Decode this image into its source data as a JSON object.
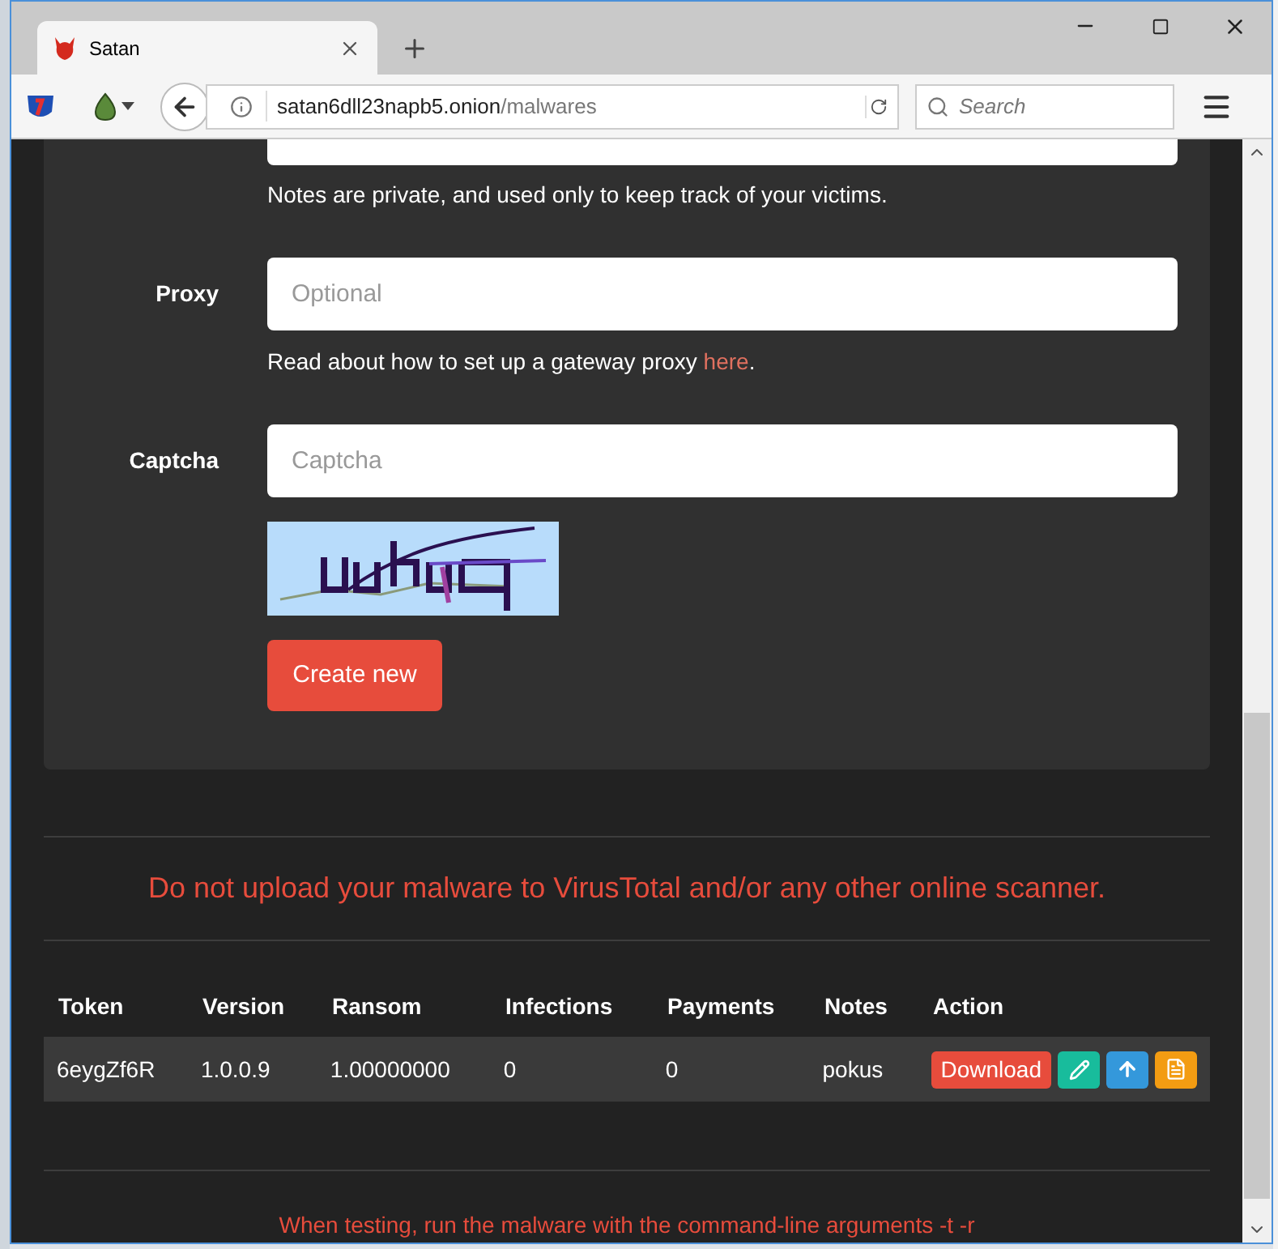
{
  "browser": {
    "tab": {
      "title": "Satan"
    },
    "address": {
      "host": "satan6dll23napb5.onion",
      "path": "/malwares"
    },
    "search": {
      "placeholder": "Search"
    }
  },
  "form": {
    "notes_help": "Notes are private, and used only to keep track of your victims.",
    "fields": [
      {
        "label": "Proxy",
        "placeholder": "Optional",
        "help": "Read about how to set up a gateway proxy ",
        "link": "here",
        "help_end": "."
      },
      {
        "label": "Captcha",
        "placeholder": "Captcha"
      }
    ],
    "submit": "Create new"
  },
  "warning": "Do not upload your malware to VirusTotal and/or any other online scanner.",
  "table": {
    "columns": [
      "Token",
      "Version",
      "Ransom",
      "Infections",
      "Payments",
      "Notes",
      "Action"
    ],
    "rows": [
      {
        "cells": [
          "6eygZf6R",
          "1.0.0.9",
          "1.00000000",
          "0",
          "0",
          "pokus"
        ],
        "actions": [
          {
            "kind": "download",
            "label": "Download"
          },
          {
            "kind": "edit"
          },
          {
            "kind": "upload"
          },
          {
            "kind": "notes"
          }
        ]
      }
    ]
  },
  "footer": "When testing, run the malware with the command-line arguments -t -r"
}
